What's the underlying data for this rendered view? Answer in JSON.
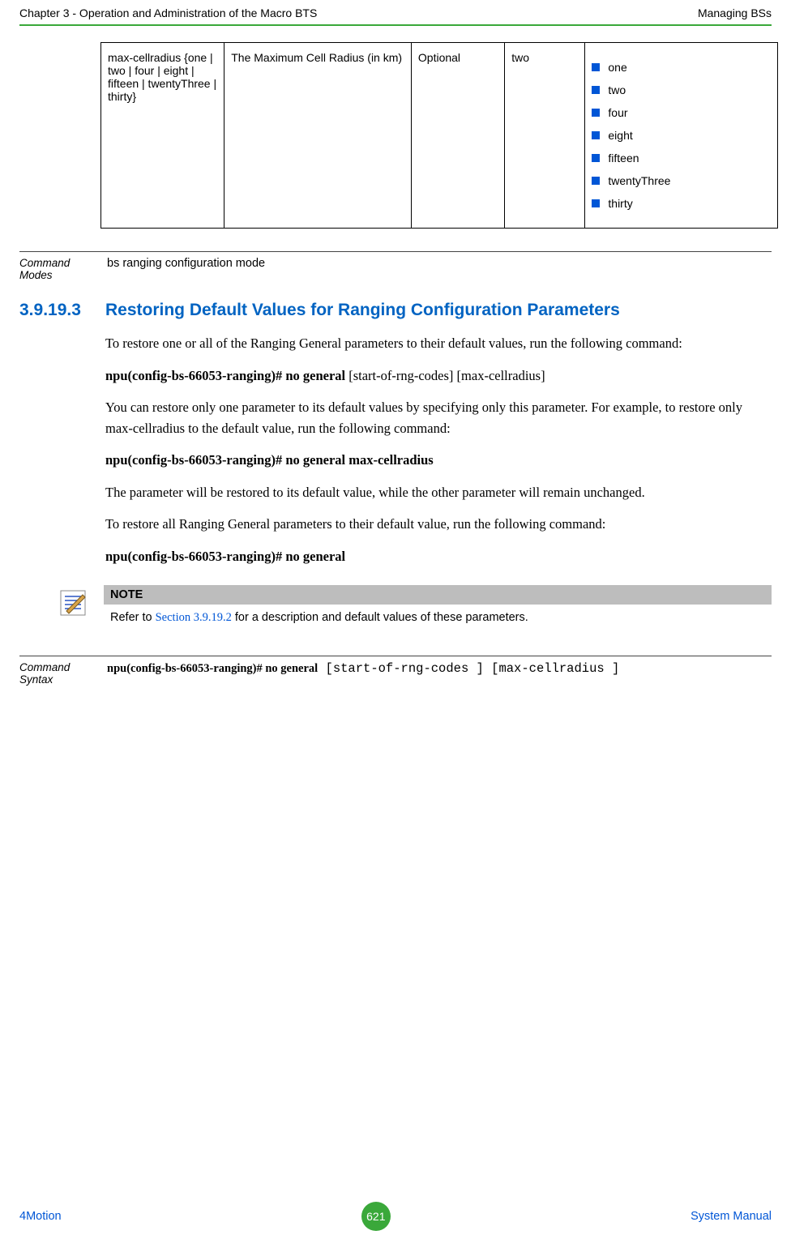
{
  "header": {
    "left": "Chapter 3 - Operation and Administration of the Macro BTS",
    "right": "Managing BSs"
  },
  "table": {
    "param_name": "max-cellradius {one | two | four | eight | fifteen | twentyThree | thirty}",
    "description": "The Maximum Cell Radius (in km)",
    "presence": "Optional",
    "default": "two",
    "range": [
      "one",
      "two",
      "four",
      "eight",
      "fifteen",
      "twentyThree",
      "thirty"
    ]
  },
  "command_modes": {
    "label": "Command Modes",
    "value": "bs ranging configuration mode"
  },
  "section": {
    "number": "3.9.19.3",
    "title": "Restoring Default Values for Ranging Configuration Parameters",
    "paragraphs": {
      "p1": "To restore one or all of the Ranging General parameters to their default values, run the following command:",
      "cmd1_bold": "npu(config-bs-66053-ranging)# no general",
      "cmd1_rest": " [start-of-rng-codes]  [max-cellradius]",
      "p2": "You can restore only one parameter to its default values by specifying only this parameter. For example, to restore only max-cellradius to the default value, run the following command:",
      "cmd2": "npu(config-bs-66053-ranging)# no general max-cellradius",
      "p3": "The parameter will be restored to its default value, while the other parameter will remain unchanged.",
      "p4": "To restore all Ranging General parameters to their default value, run the following command:",
      "cmd3": "npu(config-bs-66053-ranging)# no general"
    }
  },
  "note": {
    "heading": "NOTE",
    "prefix": "Refer to ",
    "link": "Section 3.9.19.2",
    "suffix": " for a description and default values of these parameters.",
    "icon_name": "pencil-note-icon"
  },
  "command_syntax": {
    "label": "Command Syntax",
    "bold": "npu(config-bs-66053-ranging)# no general",
    "mono": " [start-of-rng-codes ] [max-cellradius ]"
  },
  "footer": {
    "left": "4Motion",
    "page": "621",
    "right": "System Manual"
  }
}
